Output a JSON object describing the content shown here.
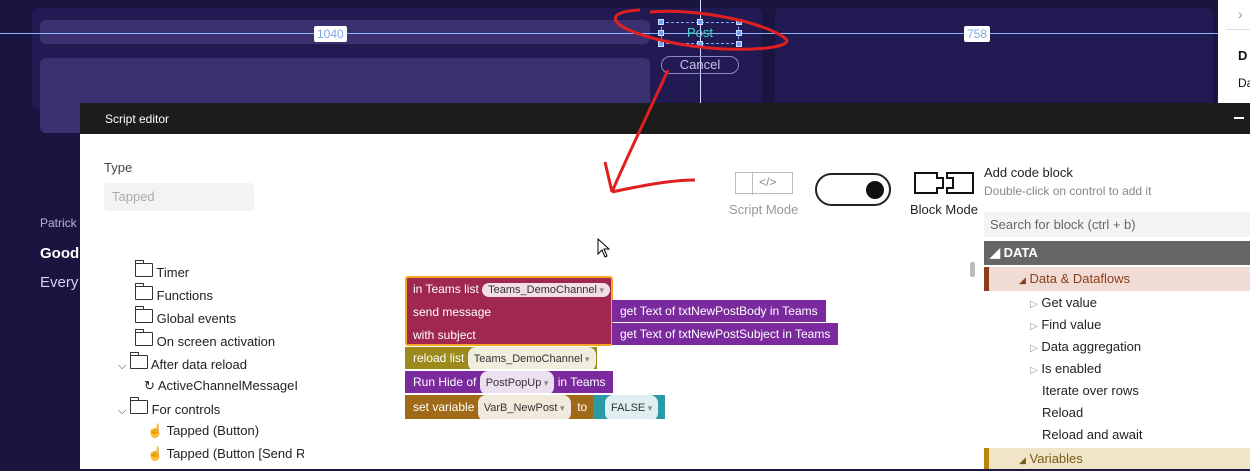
{
  "canvas": {
    "dimension_width": "1040",
    "dimension_right": "758",
    "post_label": "Post",
    "cancel_label": "Cancel",
    "user_name": "Patrick",
    "greeting": "Good",
    "sub_text": "Every",
    "right_panel_heading": "D",
    "right_panel_sub": "Da"
  },
  "editor": {
    "title": "Script editor",
    "type_label": "Type",
    "type_value": "Tapped",
    "script_mode_label": "Script Mode",
    "block_mode_label": "Block Mode",
    "add_code_block_title": "Add code block",
    "add_code_block_hint": "Double-click on control to add it",
    "search_placeholder": "Search for block (ctrl + b)"
  },
  "tree": {
    "items": [
      {
        "label": "Timer"
      },
      {
        "label": "Functions"
      },
      {
        "label": "Global events"
      },
      {
        "label": "On screen activation"
      },
      {
        "label": "After data reload"
      },
      {
        "label": "ActiveChannelMessageI"
      },
      {
        "label": "For controls"
      },
      {
        "label": "Tapped (Button)"
      },
      {
        "label": "Tapped (Button [Send Re"
      }
    ]
  },
  "blocks": {
    "b1_prefix": "in Teams list",
    "b1_list": "Teams_DemoChannel",
    "b1_send": "send message",
    "b1_subject": "with subject",
    "b1_msg_value": "get Text of txtNewPostBody in Teams",
    "b1_subj_value": "get Text of txtNewPostSubject in Teams",
    "b2_prefix": "reload list",
    "b2_list": "Teams_DemoChannel",
    "b3_prefix": "Run Hide of",
    "b3_target": "PostPopUp",
    "b3_suffix": "in Teams",
    "b4_prefix": "set variable",
    "b4_var": "VarB_NewPost",
    "b4_to": "to",
    "b4_value": "FALSE"
  },
  "palette": {
    "section": "DATA",
    "subsection": "Data & Dataflows",
    "items": [
      {
        "label": "Get value"
      },
      {
        "label": "Find value"
      },
      {
        "label": "Data aggregation"
      },
      {
        "label": "Is enabled"
      },
      {
        "label": "Iterate over rows"
      },
      {
        "label": "Reload"
      },
      {
        "label": "Reload and await"
      }
    ],
    "variables": "Variables"
  },
  "colors": {
    "canvas_bg": "#1a1540",
    "annotation_red": "#e02020",
    "data_block": "#a0284f",
    "reload_block": "#9c8a1c",
    "run_block": "#7a2a9c",
    "variable_block": "#a06a18",
    "value_block": "#2a9ba6",
    "getter_block": "#7b2a9e"
  }
}
